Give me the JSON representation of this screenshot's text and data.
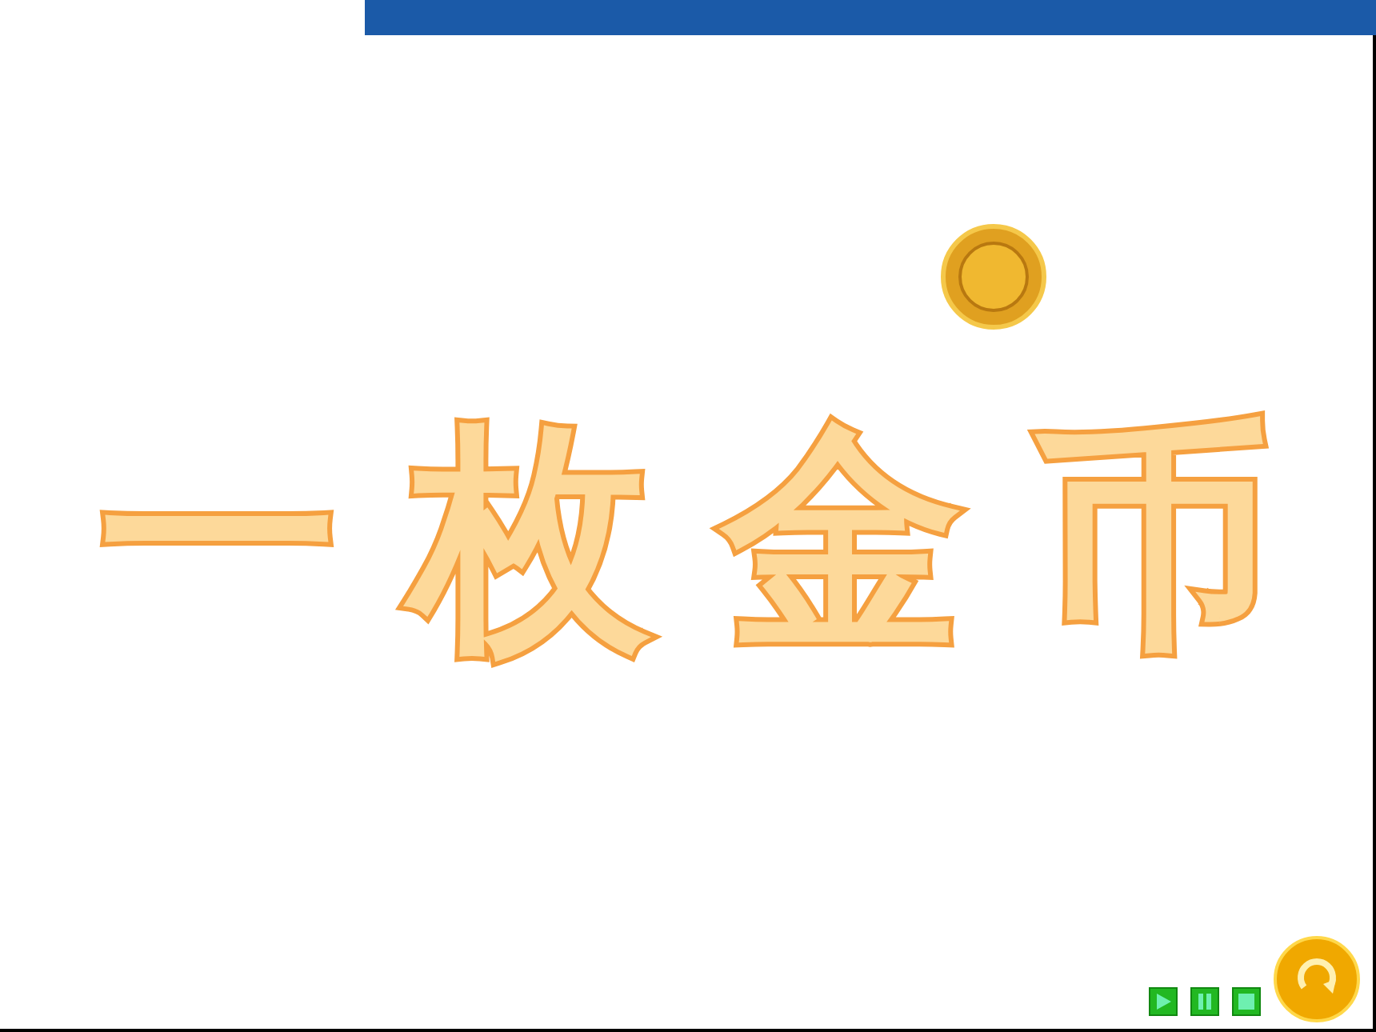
{
  "title": "一枚金币"
}
